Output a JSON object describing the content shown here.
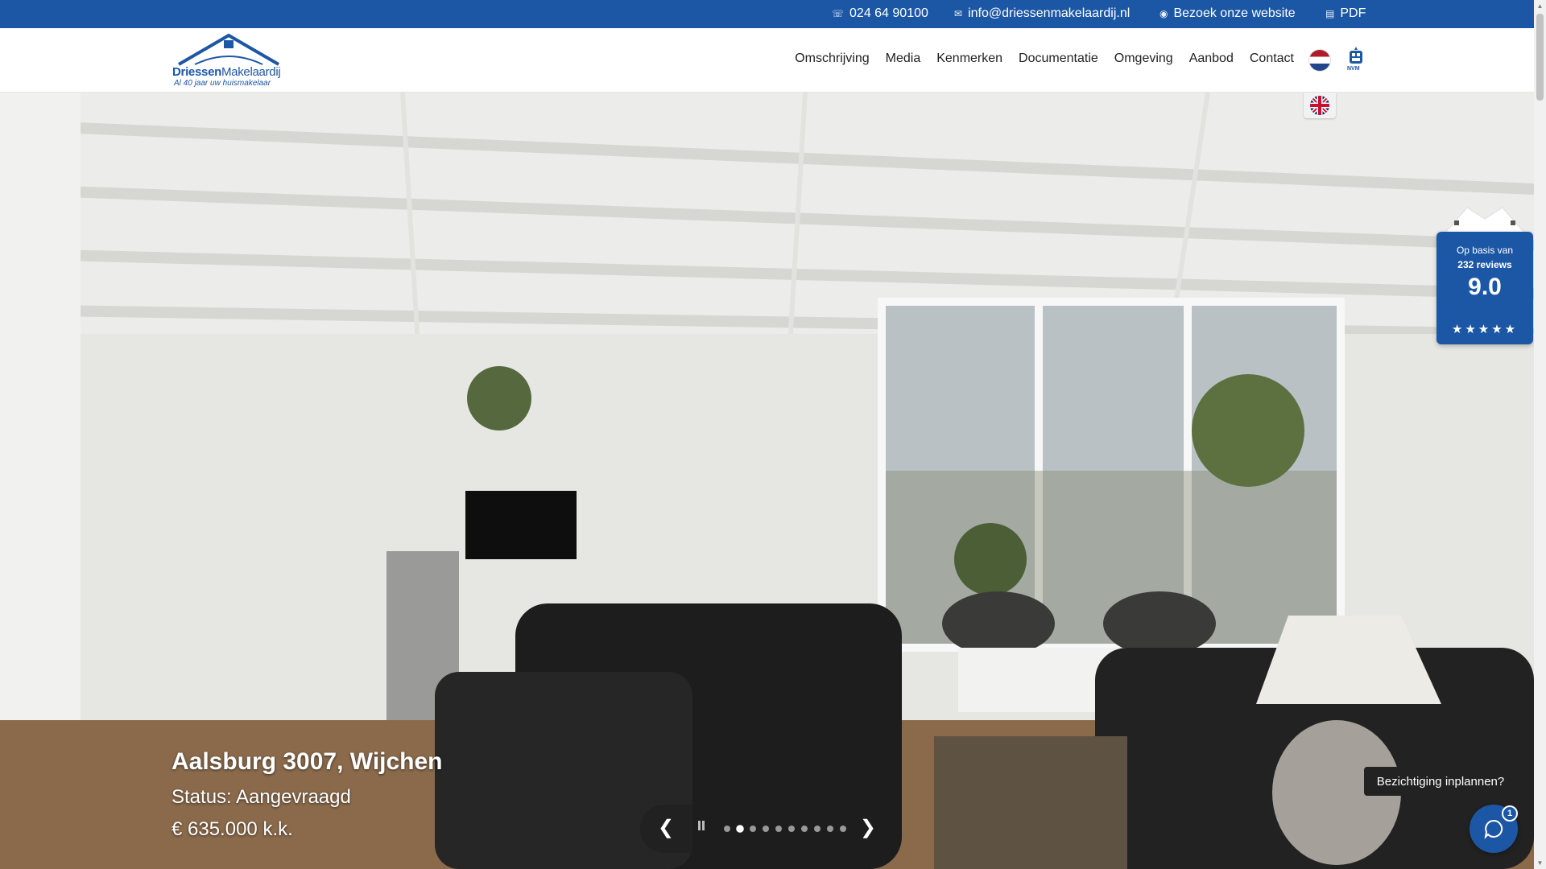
{
  "topbar": {
    "phone": "024 64 90100",
    "email": "info@driessenmakelaardij.nl",
    "website": "Bezoek onze website",
    "pdf": "PDF"
  },
  "logo": {
    "brand_bold": "Driessen",
    "brand_regular": "Makelaardij",
    "tagline": "Al 40 jaar uw huismakelaar"
  },
  "nav": {
    "items": [
      "Omschrijving",
      "Media",
      "Kenmerken",
      "Documentatie",
      "Omgeving",
      "Aanbod",
      "Contact"
    ]
  },
  "hero": {
    "title": "Aalsburg 3007, Wijchen",
    "status": "Status: Aangevraagd",
    "price": "€ 635.000 k.k."
  },
  "slider": {
    "prev": "❮",
    "next": "❯",
    "slide_count": 10,
    "active_index": 1
  },
  "review": {
    "label": "Op basis van",
    "count": "232 reviews",
    "score": "9.0",
    "stars": 5
  },
  "chat": {
    "tooltip": "Bezichtiging inplannen?",
    "badge": "1"
  },
  "colors": {
    "brand_blue": "#1c57a5",
    "topbar": "#1c57a5"
  },
  "icons": {
    "phone": "phone-icon",
    "email": "envelope-icon",
    "web": "globe-icon",
    "pdf": "file-pdf-icon"
  }
}
